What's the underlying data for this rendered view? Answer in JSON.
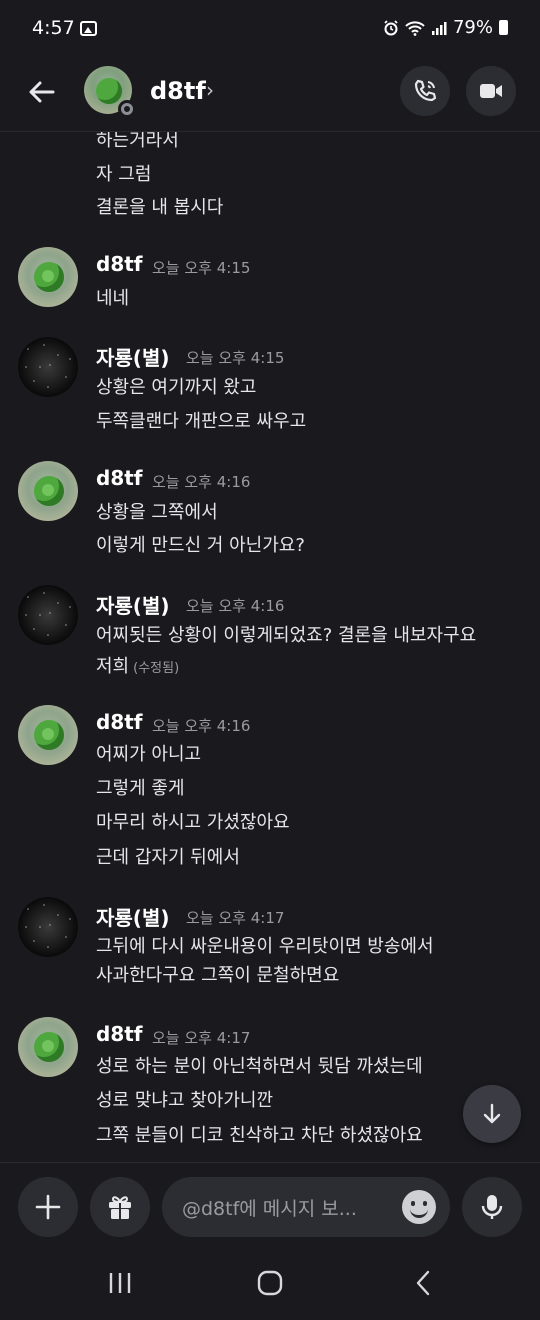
{
  "status_bar": {
    "time": "4:57",
    "battery": "79%",
    "icons": [
      "gallery-icon",
      "alarm-icon",
      "wifi-icon",
      "signal-icon",
      "battery-icon"
    ]
  },
  "header": {
    "name": "d8tf",
    "chevron": "›",
    "icons": [
      "back-arrow-icon",
      "voice-call-icon",
      "video-call-icon"
    ]
  },
  "previous_lines": [
    "하는거라서",
    "자 그럼",
    "결론을 내 봅시다"
  ],
  "messages": [
    {
      "author": "d8tf",
      "avatar": "turtle-avatar",
      "timestamp": "오늘 오후 4:15",
      "lines": [
        "네네"
      ]
    },
    {
      "author": "자룡(별)",
      "avatar": "stars-avatar",
      "timestamp": "오늘 오후 4:15",
      "lines": [
        "상황은 여기까지 왔고",
        "두쪽클랜다 개판으로 싸우고"
      ]
    },
    {
      "author": "d8tf",
      "avatar": "turtle-avatar",
      "timestamp": "오늘 오후 4:16",
      "lines": [
        "상황을 그쪽에서",
        "이렇게 만드신 거 아닌가요?"
      ]
    },
    {
      "author": "자룡(별)",
      "avatar": "stars-avatar",
      "timestamp": "오늘 오후 4:16",
      "lines": [
        "어찌됫든 상황이 이렇게되었죠? 결론을 내보자구요",
        "저희"
      ],
      "edited": "(수정됨)"
    },
    {
      "author": "d8tf",
      "avatar": "turtle-avatar",
      "timestamp": "오늘 오후 4:16",
      "lines": [
        "어찌가 아니고",
        "그렇게 좋게",
        "마무리 하시고 가셨잖아요",
        "근데 갑자기 뒤에서"
      ]
    },
    {
      "author": "자룡(별)",
      "avatar": "stars-avatar",
      "timestamp": "오늘 오후 4:17",
      "lines": [
        "그뒤에 다시 싸운내용이 우리탓이면 방송에서",
        "사과한다구요 그쪽이 문철하면요"
      ]
    },
    {
      "author": "d8tf",
      "avatar": "turtle-avatar",
      "timestamp": "오늘 오후 4:17",
      "lines": [
        "성로 하는 분이 아닌척하면서 뒷담 까셨는데",
        "성로 맞냐고 찾아가니깐",
        "그쪽 분들이 디코 친삭하고 차단 하셨잖아요"
      ]
    }
  ],
  "composer": {
    "placeholder": "@d8tf에 메시지 보...",
    "icons": [
      "plus-icon",
      "gift-icon",
      "emoji-icon",
      "microphone-icon"
    ]
  },
  "nav": {
    "icons": [
      "recent-apps-icon",
      "home-icon",
      "back-icon"
    ]
  },
  "colors": {
    "background": "#1a1a1e",
    "surface": "#2c2d33",
    "text": "#e6e6e8",
    "muted": "#9a9ba1"
  }
}
